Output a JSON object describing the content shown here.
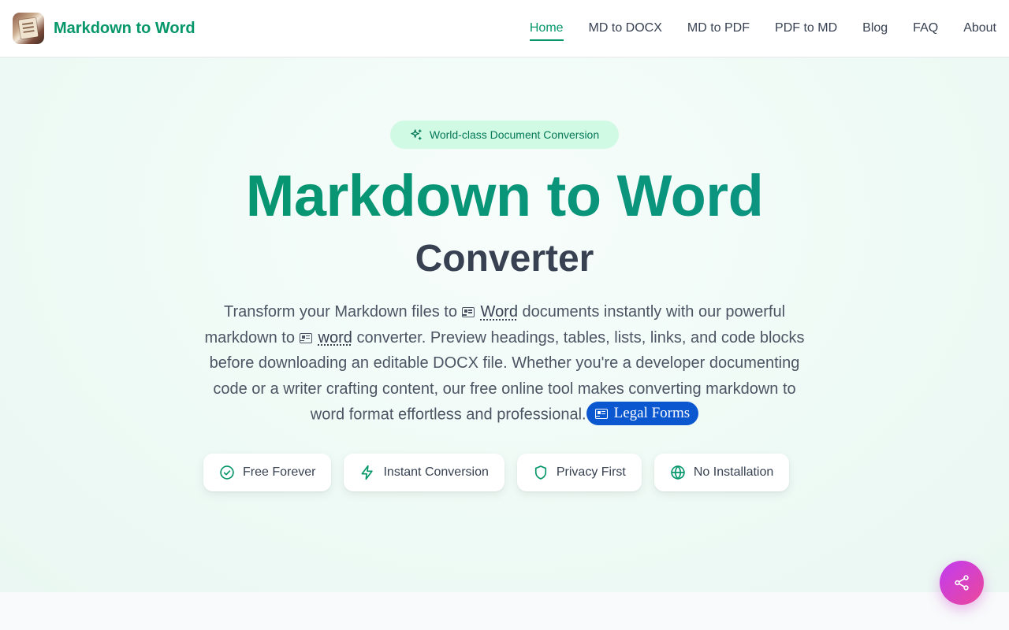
{
  "header": {
    "brand": "Markdown to Word",
    "nav": [
      "Home",
      "MD to DOCX",
      "MD to PDF",
      "PDF to MD",
      "Blog",
      "FAQ",
      "About"
    ],
    "active": "Home"
  },
  "hero": {
    "badge": "World-class Document Conversion",
    "title": "Markdown to Word",
    "subtitle": "Converter",
    "desc": {
      "part1": "Transform your Markdown files to ",
      "link1": "Word",
      "part2": " documents instantly with our powerful markdown to ",
      "link2": "word",
      "part3": " converter. Preview headings, tables, lists, links, and code blocks before downloading an editable DOCX file. Whether you're a developer documenting code or a writer crafting content, our free online tool makes converting markdown to word format effortless and professional.",
      "pill": "Legal Forms"
    },
    "features": [
      {
        "label": "Free Forever",
        "icon": "check-circle-icon"
      },
      {
        "label": "Instant Conversion",
        "icon": "lightning-icon"
      },
      {
        "label": "Privacy First",
        "icon": "shield-icon"
      },
      {
        "label": "No Installation",
        "icon": "globe-icon"
      }
    ]
  },
  "share": {
    "icon": "share-icon"
  },
  "colors": {
    "brand": "#059669",
    "badge_bg": "#d1fae5",
    "pill": "#0b57d0",
    "share_from": "#c13bf2",
    "share_to": "#ec4899"
  }
}
